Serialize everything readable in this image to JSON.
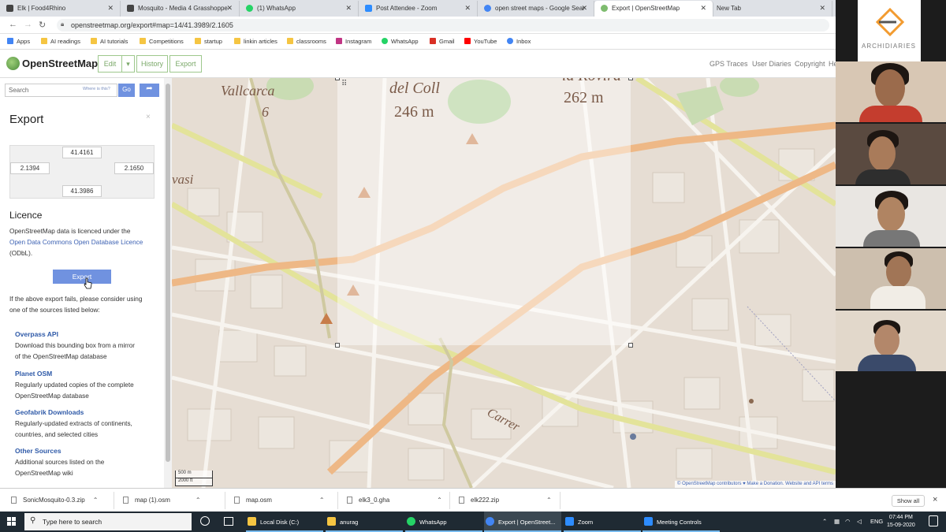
{
  "browser": {
    "tabs": [
      {
        "label": "Elk | Food4Rhino",
        "color": "#444"
      },
      {
        "label": "Mosquito - Media 4 Grasshoppe",
        "color": "#444"
      },
      {
        "label": "(1) WhatsApp",
        "color": "#25d366"
      },
      {
        "label": "Post Attendee - Zoom",
        "color": "#2d8cff"
      },
      {
        "label": "open street maps - Google Sear",
        "color": "#4285f4"
      },
      {
        "label": "Export | OpenStreetMap",
        "color": "#7ebc6f"
      },
      {
        "label": "New Tab",
        "color": ""
      }
    ],
    "url": "openstreetmap.org/export#map=14/41.3989/2.1605",
    "bookmarks": [
      {
        "label": "Apps",
        "color": "#4285f4"
      },
      {
        "label": "AI readings",
        "color": "#f5c542"
      },
      {
        "label": "AI tutorials",
        "color": "#f5c542"
      },
      {
        "label": "Competitions",
        "color": "#f5c542"
      },
      {
        "label": "startup",
        "color": "#f5c542"
      },
      {
        "label": "linkin articles",
        "color": "#f5c542"
      },
      {
        "label": "classrooms",
        "color": "#f5c542"
      },
      {
        "label": "Instagram",
        "color": "#c13584"
      },
      {
        "label": "WhatsApp",
        "color": "#25d366"
      },
      {
        "label": "Gmail",
        "color": "#d93025"
      },
      {
        "label": "YouTube",
        "color": "#ff0000"
      },
      {
        "label": "Inbox",
        "color": "#4285f4"
      }
    ]
  },
  "osm": {
    "brand": "OpenStreetMap",
    "edit": "Edit",
    "dropdown": "▾",
    "history": "History",
    "export": "Export",
    "gps": "GPS Traces",
    "diaries": "User Diaries",
    "copyright": "Copyright",
    "help": "He"
  },
  "sidebar": {
    "search_placeholder": "Search",
    "where_is_this": "Where is this?",
    "go": "Go",
    "title": "Export",
    "close": "×",
    "bbox": {
      "north": "41.4161",
      "west": "2.1394",
      "east": "2.1650",
      "south": "41.3986"
    },
    "licence_title": "Licence",
    "licence_line1": "OpenStreetMap data is licenced under the",
    "licence_link": "Open Data Commons Open Database Licence",
    "licence_line3": "(ODbL).",
    "export_button": "Export",
    "fail_line1": "If the above export fails, please consider using",
    "fail_line2": "one of the sources listed below:",
    "sources": [
      {
        "title": "Overpass API",
        "l1": "Download this bounding box from a mirror",
        "l2": "of the OpenStreetMap database"
      },
      {
        "title": "Planet OSM",
        "l1": "Regularly updated copies of the complete",
        "l2": "OpenStreetMap database"
      },
      {
        "title": "Geofabrik Downloads",
        "l1": "Regularly-updated extracts of continents,",
        "l2": "countries, and selected cities"
      },
      {
        "title": "Other Sources",
        "l1": "Additional sources listed on the",
        "l2": "OpenStreetMap wiki"
      }
    ]
  },
  "map": {
    "labels": {
      "vallcarca": "Vallcarca",
      "six": "6",
      "vasi": "vasi",
      "delcoll": "del Coll",
      "m246": "246 m",
      "rovira": "la Rovira",
      "m262": "262 m",
      "carrer": "Carrer"
    },
    "scale_m": "500 m",
    "scale_ft": "2000 ft",
    "attribution": "© OpenStreetMap contributors ♥ Make a Donation. Website and API terms"
  },
  "zoom": {
    "brand": "ARCHIDIARIES"
  },
  "downloads": {
    "items": [
      "SonicMosquito-0.3.zip",
      "map (1).osm",
      "map.osm",
      "elk3_0.gha",
      "elk222.zip"
    ],
    "show_all": "Show all",
    "close": "×"
  },
  "taskbar": {
    "search": "Type here to search",
    "items": [
      {
        "label": "Local Disk (C:)",
        "color": "#f5c542"
      },
      {
        "label": "anurag",
        "color": "#f5c542"
      },
      {
        "label": "WhatsApp",
        "color": "#25d366"
      },
      {
        "label": "Export | OpenStreet...",
        "color": "#4285f4"
      },
      {
        "label": "Zoom",
        "color": "#2d8cff"
      },
      {
        "label": "Meeting Controls",
        "color": "#2d8cff"
      }
    ],
    "lang": "ENG",
    "time": "07:44 PM",
    "date": "15-09-2020"
  }
}
